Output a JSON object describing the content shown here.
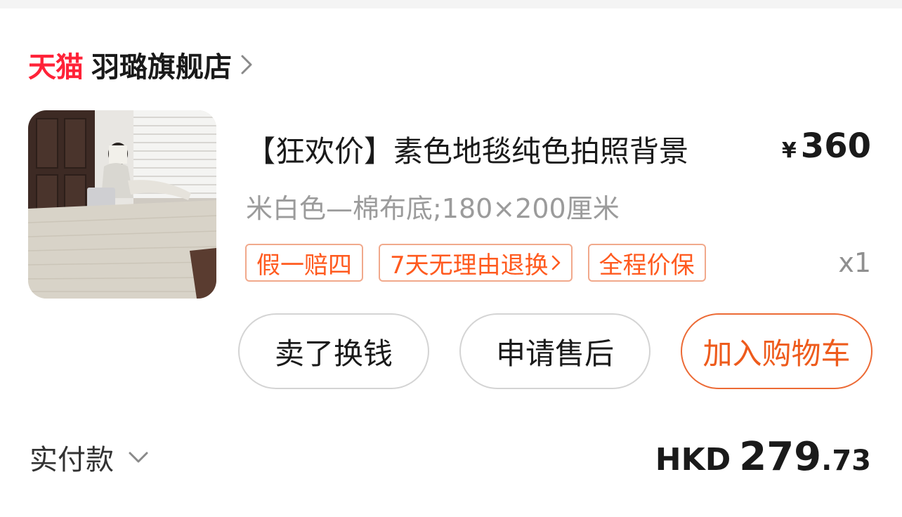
{
  "store": {
    "logo_text": "天猫",
    "name": "羽璐旗舰店",
    "icons": {
      "chevron": "chevron-right-icon"
    }
  },
  "product": {
    "image_alt": "素色地毯",
    "title": "【狂欢价】素色地毯纯色拍照背景",
    "price_currency": "¥",
    "price_value": "360",
    "sku": "米白色—棉布底;180×200厘米",
    "quantity": "x1",
    "tags": [
      {
        "label": "假一赔四"
      },
      {
        "label": "7天无理由退换"
      },
      {
        "label": "全程价保"
      }
    ]
  },
  "actions": {
    "sell_label": "卖了换钱",
    "after_sales_label": "申请售后",
    "add_cart_label": "加入购物车"
  },
  "payment": {
    "label": "实付款",
    "currency": "HKD",
    "amount_int": "279",
    "amount_dec": ".73"
  },
  "colors": {
    "tmall_red": "#ff2238",
    "accent_orange": "#ee5b1c",
    "tag_border": "#f1a98c",
    "muted_text": "#9b9b9b"
  }
}
